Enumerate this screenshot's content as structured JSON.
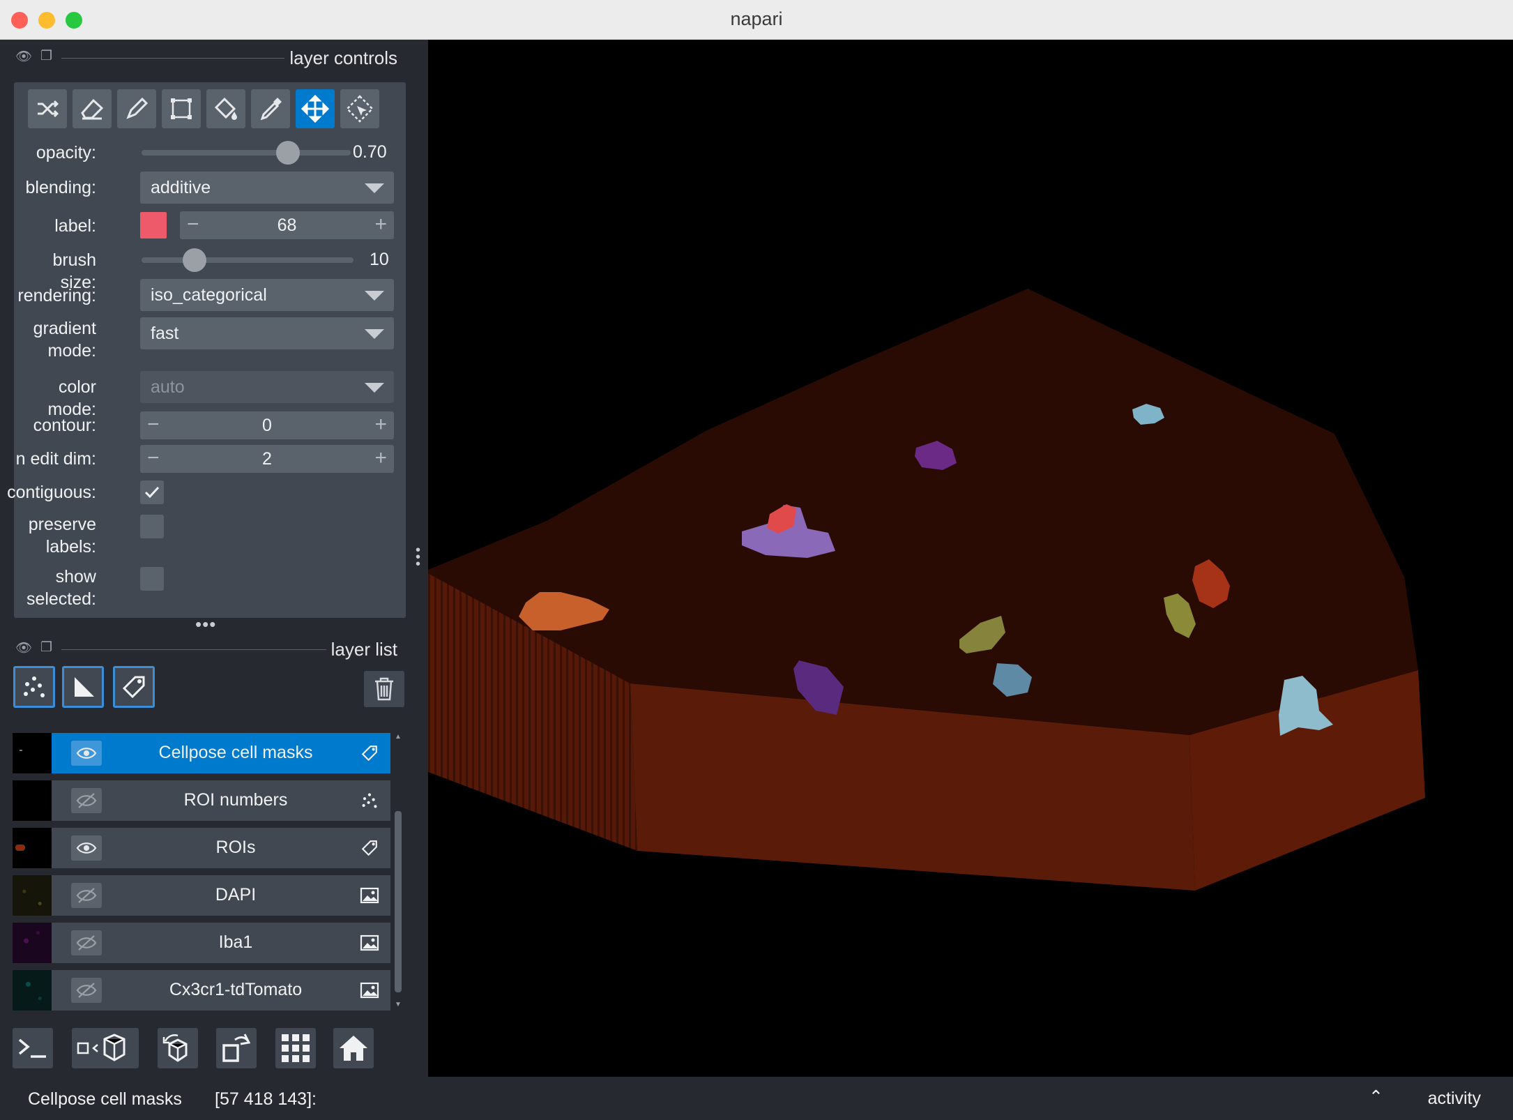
{
  "window": {
    "title": "napari",
    "traffic_lights": {
      "close": "#ff5f57",
      "minimize": "#febc2e",
      "zoom": "#28c840"
    }
  },
  "layer_controls": {
    "header": "layer controls",
    "tools": [
      {
        "name": "shuffle-colors-icon",
        "active": false
      },
      {
        "name": "eraser-icon",
        "active": false
      },
      {
        "name": "paintbrush-icon",
        "active": false
      },
      {
        "name": "polygon-icon",
        "active": false
      },
      {
        "name": "fill-bucket-icon",
        "active": false
      },
      {
        "name": "color-picker-icon",
        "active": false
      },
      {
        "name": "pan-zoom-icon",
        "active": true
      },
      {
        "name": "transform-icon",
        "active": false
      }
    ],
    "opacity": {
      "label": "opacity:",
      "value": "0.70",
      "fraction": 0.7
    },
    "blending": {
      "label": "blending:",
      "value": "additive"
    },
    "label": {
      "label": "label:",
      "value": "68",
      "color": "#ef5a6b"
    },
    "brush_size": {
      "label": "brush size:",
      "value": "10",
      "fraction": 0.25
    },
    "rendering": {
      "label": "rendering:",
      "value": "iso_categorical"
    },
    "gradient_mode": {
      "label_line1": "gradient",
      "label_line2": "mode:",
      "value": "fast"
    },
    "color_mode": {
      "label": "color mode:",
      "value": "auto"
    },
    "contour": {
      "label": "contour:",
      "value": "0"
    },
    "n_edit_dim": {
      "label": "n edit dim:",
      "value": "2"
    },
    "contiguous": {
      "label": "contiguous:",
      "checked": true
    },
    "preserve_labels": {
      "label_line1": "preserve",
      "label_line2": "labels:",
      "checked": false
    },
    "show_selected": {
      "label_line1": "show",
      "label_line2": "selected:",
      "checked": false
    }
  },
  "layer_list": {
    "header": "layer list",
    "new_layer_buttons": [
      "new-points-layer-icon",
      "new-shapes-layer-icon",
      "new-labels-layer-icon"
    ],
    "delete_icon": "trash-icon",
    "layers": [
      {
        "name": "Cellpose cell masks",
        "visible": true,
        "selected": true,
        "type": "labels-icon"
      },
      {
        "name": "ROI numbers",
        "visible": false,
        "selected": false,
        "type": "points-icon"
      },
      {
        "name": "ROIs",
        "visible": true,
        "selected": false,
        "type": "labels-icon"
      },
      {
        "name": "DAPI",
        "visible": false,
        "selected": false,
        "type": "image-icon"
      },
      {
        "name": "Iba1",
        "visible": false,
        "selected": false,
        "type": "image-icon"
      },
      {
        "name": "Cx3cr1-tdTomato",
        "visible": false,
        "selected": false,
        "type": "image-icon"
      }
    ]
  },
  "viewer_buttons": [
    "console-icon",
    "ndisplay-toggle-icon",
    "roll-dims-icon",
    "transpose-icon",
    "grid-view-icon",
    "home-icon"
  ],
  "status_bar": {
    "layer": "Cellpose cell masks",
    "coords": "[57 418 143]:",
    "activity": "activity"
  }
}
